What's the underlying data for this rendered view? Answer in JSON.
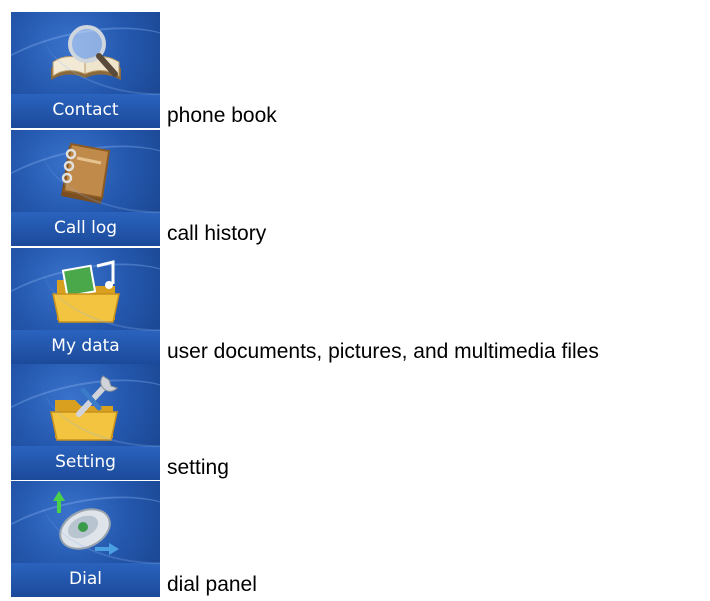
{
  "menu": {
    "items": [
      {
        "label": "Contact",
        "description": "phone book",
        "icon": "address-book-magnifier-icon"
      },
      {
        "label": "Call log",
        "description": "call history",
        "icon": "notebook-icon"
      },
      {
        "label": "My data",
        "description": "user documents, pictures, and multimedia files",
        "icon": "folder-media-icon"
      },
      {
        "label": "Setting",
        "description": "setting",
        "icon": "folder-wrench-icon"
      },
      {
        "label": "Dial",
        "description": "dial panel",
        "icon": "phone-dial-icon"
      }
    ]
  }
}
